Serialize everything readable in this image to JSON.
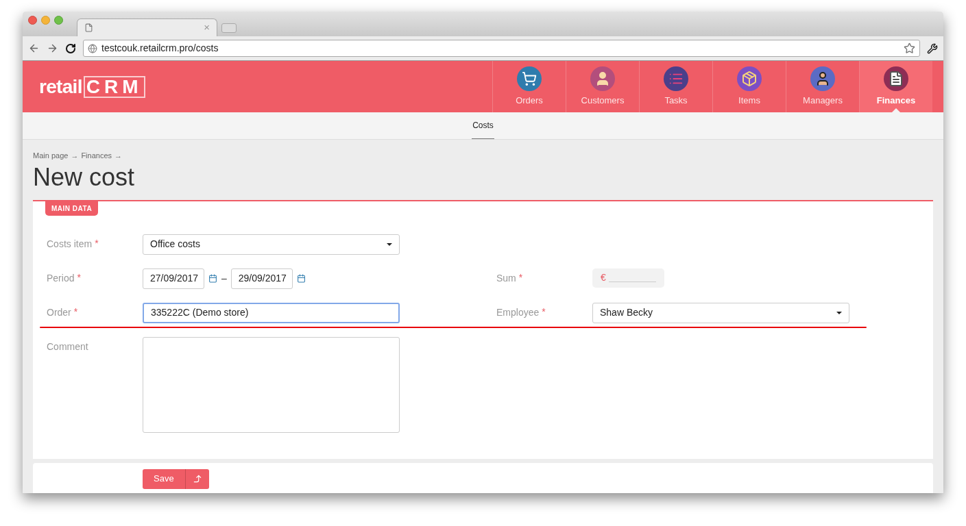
{
  "browser": {
    "tab_close": "×",
    "url": "testcouk.retailcrm.pro/costs"
  },
  "header": {
    "logo": {
      "prefix": "retail",
      "suffix": "CRM"
    },
    "nav": [
      {
        "label": "Orders",
        "selected": false
      },
      {
        "label": "Customers",
        "selected": false
      },
      {
        "label": "Tasks",
        "selected": false
      },
      {
        "label": "Items",
        "selected": false
      },
      {
        "label": "Managers",
        "selected": false
      },
      {
        "label": "Finances",
        "selected": true
      }
    ]
  },
  "subnav": [
    {
      "label": "Costs",
      "selected": true
    }
  ],
  "breadcrumbs": [
    {
      "label": "Main page",
      "separator": "→"
    },
    {
      "label": "Finances",
      "separator": "→"
    }
  ],
  "title": "New cost",
  "section": {
    "tag": "MAIN DATA",
    "rows": [
      [
        {
          "kind": "select",
          "label": "Costs item",
          "required_mark": "*",
          "value": "Office costs"
        }
      ],
      [
        {
          "kind": "daterange",
          "label": "Period",
          "required_mark": "*",
          "from": "27/09/2017",
          "to": "29/09/2017",
          "dash": "–"
        },
        {
          "kind": "money",
          "label": "Sum",
          "required_mark": "*",
          "currency": "€"
        }
      ],
      [
        {
          "kind": "text",
          "label": "Order",
          "required_mark": "*",
          "value": "335222C (Demo store)",
          "focused": true
        },
        {
          "kind": "select",
          "label": "Employee",
          "required_mark": "*",
          "value": "Shaw Becky"
        }
      ],
      [
        {
          "kind": "textarea",
          "label": "Comment"
        }
      ]
    ]
  },
  "footer": {
    "save": "Save"
  }
}
